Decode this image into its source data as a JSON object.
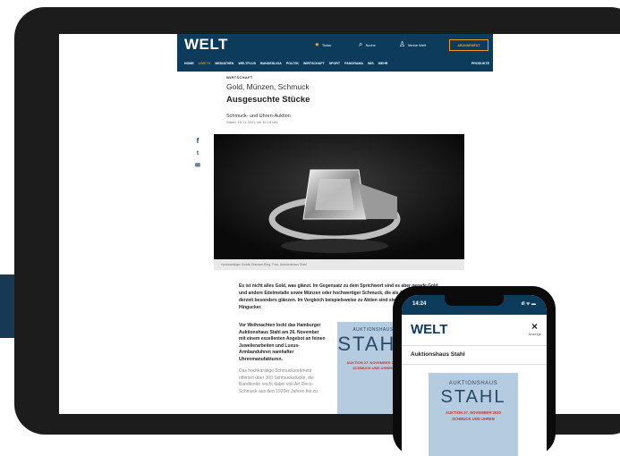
{
  "header": {
    "logo": "WELT",
    "util": {
      "ticker": "Ticker",
      "search": "Suche",
      "account": "Meine Welt"
    },
    "subscribe": "ABONNEMENT",
    "nav": [
      "HOME",
      "LIVE TV",
      "MEDIATHEK",
      "WELTPLUS",
      "BUNDESLIGA",
      "POLITIK",
      "WIRTSCHAFT",
      "SPORT",
      "PANORAMA",
      "WIS",
      "MEHR"
    ],
    "products": "PRODUKTE"
  },
  "article": {
    "section": "WIRTSCHAFT",
    "kicker": "Gold, Münzen, Schmuck",
    "headline": "Ausgesuchte Stücke",
    "subline": "Schmuck- und Uhren-Auktion",
    "date": "Stand: 15.11.2021 um 16:15 Uhr",
    "caption": "Hochkarätiger Solitär-Diamant-Ring, Foto: Auktionshaus Stahl",
    "lead": "Es ist nicht alles Gold, was glänzt. Im Gegensatz zu dem Sprichwort sind es aber gerade Gold und andere Edelmetalle sowie Münzen oder hochwertiger Schmuck, die als Anlagewerte derzeit besonders glänzen. Im Vergleich beispielsweise zu Aktien sind sie zudem echte Hingucker.",
    "col_bold": "Vor Weihnachten lockt das Hamburger Auktionshaus Stahl am 26. November mit einem exzellenten Angebot an feinen Juwelierarbeiten und Luxus-Armbanduhren namhafter Uhrenmanufakturen.",
    "col_normal": "Das hochkarätige Schmucksortiment offeriert über 300 Schmuckstücke, die Bandbreite reicht dabei von Art Deco-Schmuck aus den 1920er Jahren bis zu"
  },
  "share": {
    "facebook": "f",
    "twitter": "t",
    "mail": "✉"
  },
  "ad": {
    "line1": "AUKTIONSHAUS",
    "line2": "STAHL",
    "line3": "AUKTION 27. NOVEMBER 2020",
    "line4": "SCHMUCK UND UHREN"
  },
  "phone": {
    "time": "14:24",
    "signal": "ıll ᯤ ▬",
    "logo": "WELT",
    "close": "×",
    "close_label": "Anzeige",
    "title": "Auktionshaus Stahl"
  },
  "colors": {
    "brand": "#0d3b5c",
    "accent": "#f29a1a"
  }
}
